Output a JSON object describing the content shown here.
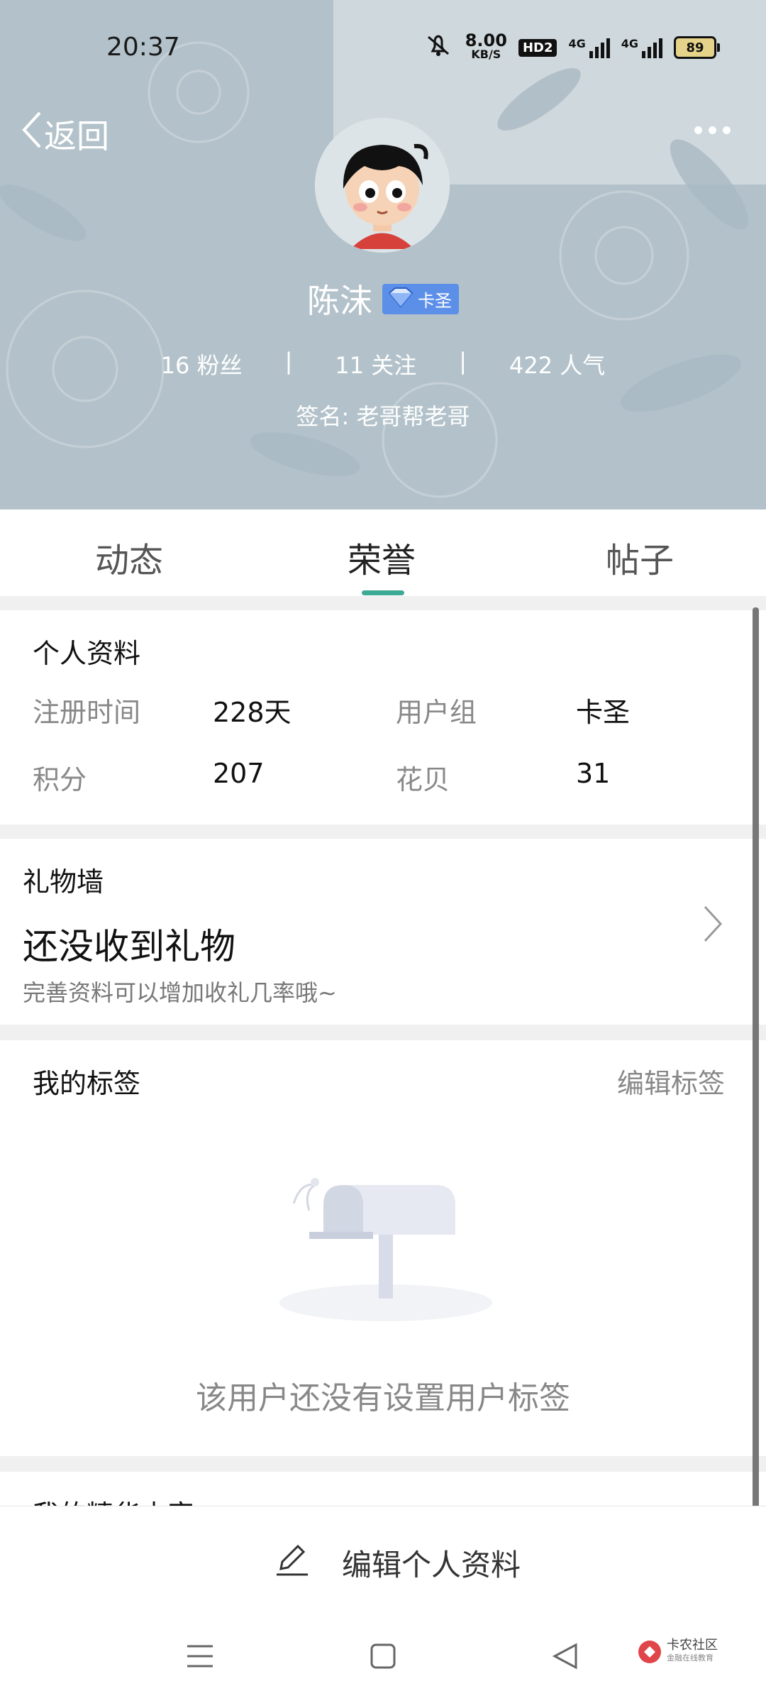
{
  "status_bar": {
    "time": "20:37",
    "net_speed_value": "8.00",
    "net_speed_unit": "KB/S",
    "hd_label": "HD2",
    "signal1_label": "4G",
    "signal2_label": "4G",
    "battery": "89"
  },
  "header": {
    "back_label": "返回",
    "username": "陈沫",
    "badge_label": "卡圣",
    "stats": [
      {
        "value": "16",
        "label": "粉丝"
      },
      {
        "value": "11",
        "label": "关注"
      },
      {
        "value": "422",
        "label": "人气"
      }
    ],
    "signature": "签名: 老哥帮老哥"
  },
  "tabs": [
    {
      "label": "动态",
      "active": false
    },
    {
      "label": "荣誉",
      "active": true
    },
    {
      "label": "帖子",
      "active": false
    }
  ],
  "profile": {
    "title": "个人资料",
    "fields": [
      {
        "label": "注册时间",
        "value": "228天"
      },
      {
        "label": "用户组",
        "value": "卡圣"
      },
      {
        "label": "积分",
        "value": "207"
      },
      {
        "label": "花贝",
        "value": "31"
      }
    ]
  },
  "gift_wall": {
    "title": "礼物墙",
    "headline": "还没收到礼物",
    "hint": "完善资料可以增加收礼几率哦~"
  },
  "tags": {
    "title": "我的标签",
    "edit_label": "编辑标签",
    "empty_text": "该用户还没有设置用户标签"
  },
  "next_section_title": "我的精华内容",
  "bottom": {
    "edit_profile_label": "编辑个人资料"
  },
  "watermark": {
    "name": "卡农社区",
    "sub": "金融在线教育"
  },
  "colors": {
    "accent": "#3daa95",
    "header_bg": "#b6c4cc",
    "badge": "#5c8fe8"
  }
}
